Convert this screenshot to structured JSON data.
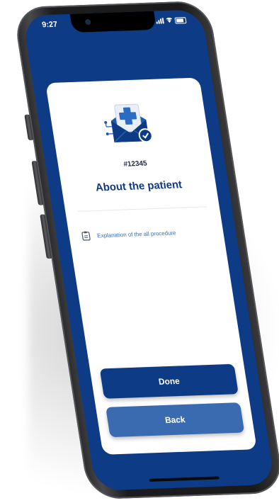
{
  "status_bar": {
    "time": "9:27"
  },
  "card": {
    "case_id": "#12345",
    "title": "About the patient",
    "items": [
      {
        "icon": "clipboard-icon",
        "text": "Explanation of the all procedure"
      }
    ]
  },
  "buttons": {
    "done_label": "Done",
    "back_label": "Back"
  },
  "colors": {
    "screen_bg": "#0d3b86",
    "primary_button": "#0d3b86",
    "secondary_button": "#3a6bb0",
    "accent_text": "#3a6bb3",
    "title_text": "#0d3b86"
  }
}
